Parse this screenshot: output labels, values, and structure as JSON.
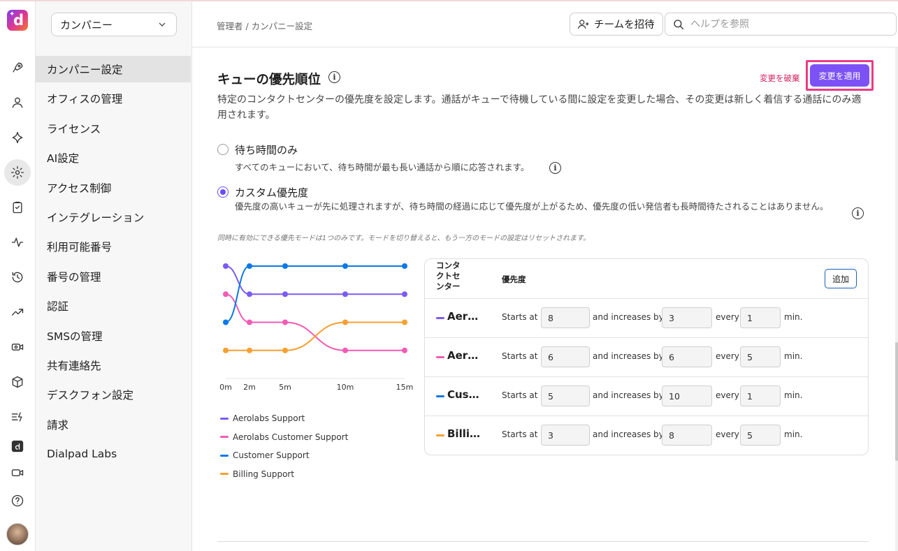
{
  "sidebar": {
    "company_select": "カンパニー",
    "items": [
      {
        "label": "カンパニー設定"
      },
      {
        "label": "オフィスの管理"
      },
      {
        "label": "ライセンス"
      },
      {
        "label": "AI設定"
      },
      {
        "label": "アクセス制御"
      },
      {
        "label": "インテグレーション"
      },
      {
        "label": "利用可能番号"
      },
      {
        "label": "番号の管理"
      },
      {
        "label": "認証"
      },
      {
        "label": "SMSの管理"
      },
      {
        "label": "共有連絡先"
      },
      {
        "label": "デスクフォン設定"
      },
      {
        "label": "請求"
      },
      {
        "label": "Dialpad Labs"
      }
    ]
  },
  "header": {
    "breadcrumb": "管理者 / カンパニー設定",
    "invite_label": "チームを招待",
    "help_placeholder": "ヘルプを参照"
  },
  "page": {
    "title": "キューの優先順位",
    "discard_label": "変更を破棄",
    "apply_label": "変更を適用",
    "description": "特定のコンタクトセンターの優先度を設定します。通話がキューで待機している間に設定を変更した場合、その変更は新しく着信する通話にのみ適用されます。",
    "options": [
      {
        "label": "待ち時間のみ",
        "desc": "すべてのキューにおいて、待ち時間が最も長い通話から順に応答されます。",
        "selected": false
      },
      {
        "label": "カスタム優先度",
        "desc": "優先度の高いキューが先に処理されますが、待ち時間の経過に応じて優先度が上がるため、優先度の低い発信者も長時間待たされることはありません。",
        "selected": true
      }
    ],
    "note": "同時に有効にできる優先モードは1つのみです。モードを切り替えると、もう一方のモードの設定はリセットされます。"
  },
  "chart_data": {
    "type": "line",
    "x": [
      "0m",
      "2m",
      "5m",
      "10m",
      "15m"
    ],
    "ylim": [
      0,
      4
    ],
    "series": [
      {
        "name": "Aerolabs Support",
        "color": "#7b5cf0",
        "values": [
          4,
          3,
          3,
          3,
          3
        ]
      },
      {
        "name": "Aerolabs Customer Support",
        "color": "#f25bb5",
        "values": [
          3,
          2,
          2,
          1,
          1
        ]
      },
      {
        "name": "Customer Support",
        "color": "#0b79e6",
        "values": [
          2,
          4,
          4,
          4,
          4
        ]
      },
      {
        "name": "Billing Support",
        "color": "#f5a030",
        "values": [
          1,
          1,
          1,
          2,
          2
        ]
      }
    ],
    "legend_position": "bottom"
  },
  "table": {
    "col_name": "コンタクトセンター",
    "col_priority": "優先度",
    "add_label": "追加",
    "starts_label": "Starts at",
    "increases_label": "and increases by",
    "every_label": "every",
    "min_label": "min.",
    "rows": [
      {
        "name": "Aerolabs Support",
        "color": "#7b5cf0",
        "start": "8",
        "increase": "3",
        "every": "1"
      },
      {
        "name": "Aerolabs Customer Support",
        "color": "#f25bb5",
        "start": "6",
        "increase": "6",
        "every": "5"
      },
      {
        "name": "Customer Support",
        "color": "#0b79e6",
        "start": "5",
        "increase": "10",
        "every": "1"
      },
      {
        "name": "Billing Support",
        "color": "#f5a030",
        "start": "3",
        "increase": "8",
        "every": "5"
      }
    ]
  },
  "rail": {
    "icons": [
      "rocket-icon",
      "person-icon",
      "sparkle-icon",
      "gear-icon",
      "clipboard-icon",
      "pulse-icon",
      "history-icon",
      "trend-icon",
      "video-gear-icon",
      "box-icon",
      "routing-icon",
      "dialpad-ai-icon",
      "video-icon",
      "help-icon"
    ]
  }
}
